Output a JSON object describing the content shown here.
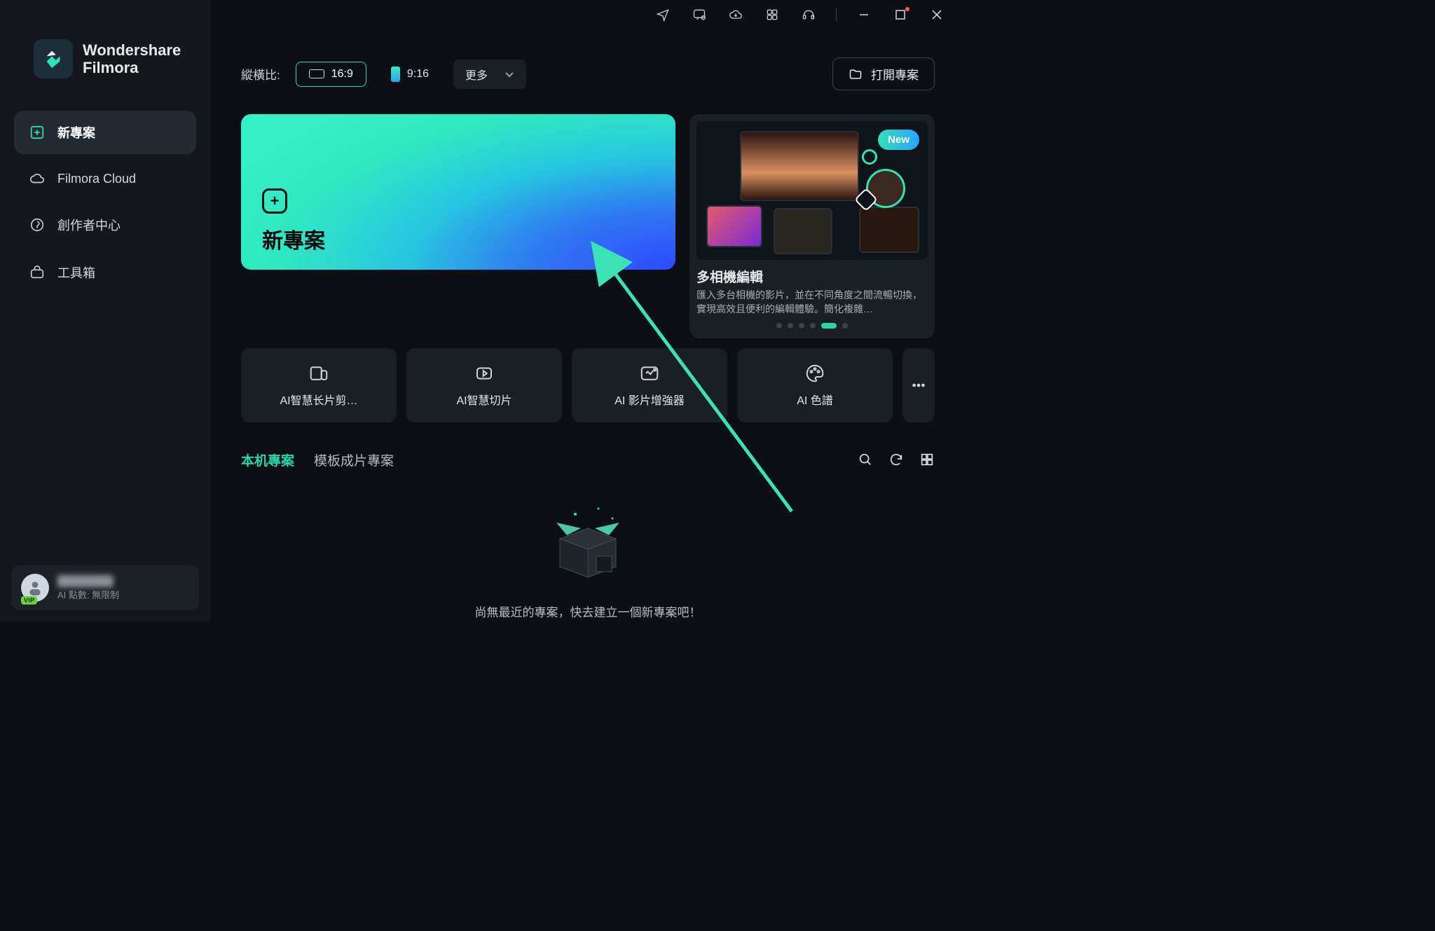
{
  "brand_line1": "Wondershare",
  "brand_line2": "Filmora",
  "nav": {
    "new_project": "新專案",
    "cloud": "Filmora Cloud",
    "creator": "創作者中心",
    "toolbox": "工具箱"
  },
  "user": {
    "vip_label": "VIP",
    "name_blurred": "████████",
    "ai_points": "AI 點數: 無限制"
  },
  "aspect": {
    "label": "縱橫比:",
    "r16_9": "16:9",
    "r9_16": "9:16",
    "more": "更多"
  },
  "open_project": "打開專案",
  "hero": {
    "plus": "+",
    "title": "新專案"
  },
  "promo": {
    "badge": "New",
    "title": "多相機編輯",
    "desc": "匯入多台相機的影片，並在不同角度之間流暢切換，實現高效且便利的編輯體驗。簡化複雜…"
  },
  "tools": {
    "t1": "AI智慧长片剪…",
    "t2": "AI智慧切片",
    "t3": "AI 影片增強器",
    "t4": "AI 色譜"
  },
  "tabs": {
    "local": "本机專案",
    "template": "模板成片專案"
  },
  "empty_text": "尚無最近的專案，快去建立一個新專案吧！"
}
